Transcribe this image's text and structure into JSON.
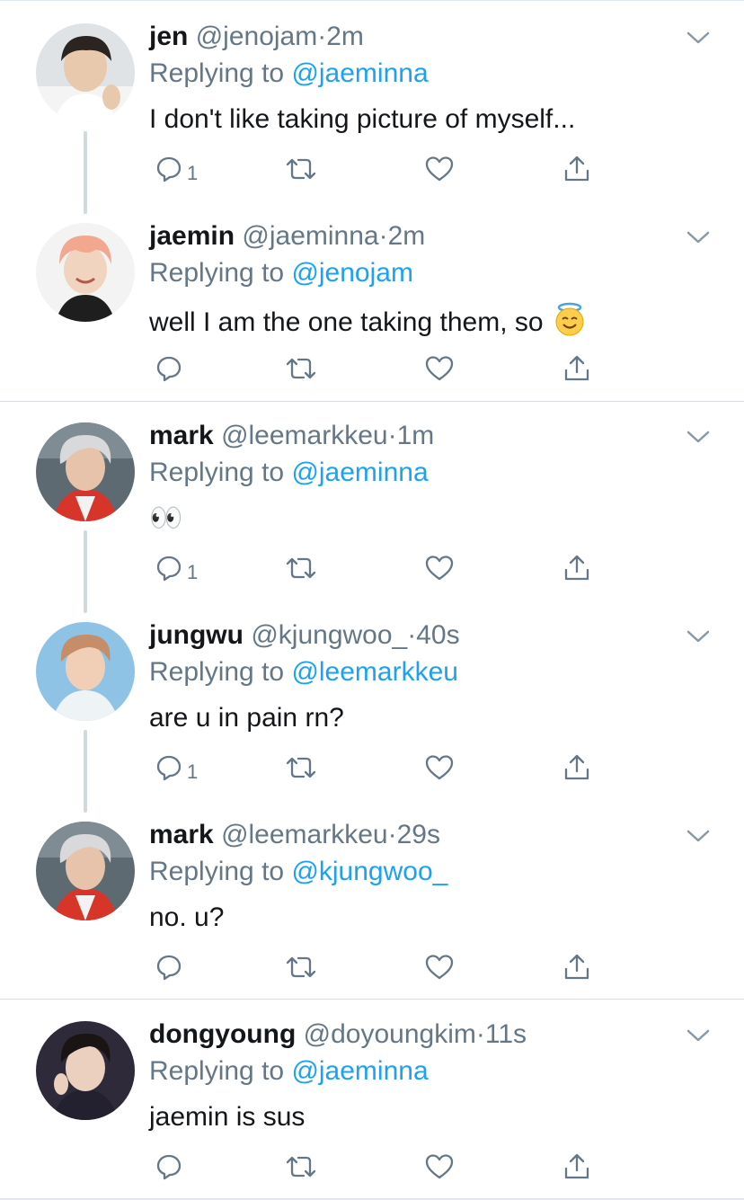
{
  "tweets": [
    {
      "name": "jen",
      "handle": "@jenojam",
      "time": "2m",
      "replying_label": "Replying to",
      "replying_to": "@jaeminna",
      "text": "I don't like taking picture of myself...",
      "reply_count": "1",
      "avatar": "avatar-jen"
    },
    {
      "name": "jaemin",
      "handle": "@jaeminna",
      "time": "2m",
      "replying_label": "Replying to",
      "replying_to": "@jenojam",
      "text": "well I am the one taking them, so",
      "text_emoji": "smiling-face-with-halo",
      "reply_count": "",
      "avatar": "avatar-jaemin"
    },
    {
      "name": "mark",
      "handle": "@leemarkkeu",
      "time": "1m",
      "replying_label": "Replying to",
      "replying_to": "@jaeminna",
      "text": "👀",
      "reply_count": "1",
      "avatar": "avatar-mark"
    },
    {
      "name": "jungwu",
      "handle": "@kjungwoo_",
      "time": "40s",
      "replying_label": "Replying to",
      "replying_to": "@leemarkkeu",
      "text": "are u in pain rn?",
      "reply_count": "1",
      "avatar": "avatar-jungwu"
    },
    {
      "name": "mark",
      "handle": "@leemarkkeu",
      "time": "29s",
      "replying_label": "Replying to",
      "replying_to": "@kjungwoo_",
      "text": "no. u?",
      "reply_count": "",
      "avatar": "avatar-mark"
    },
    {
      "name": "dongyoung",
      "handle": "@doyoungkim",
      "time": "11s",
      "replying_label": "Replying to",
      "replying_to": "@jaeminna",
      "text": "jaemin is sus",
      "reply_count": "",
      "avatar": "avatar-dongyoung"
    }
  ],
  "meta": {
    "separator_dot": "·"
  },
  "colors": {
    "accent": "#1da1f2",
    "secondary_text": "#657786",
    "primary_text": "#14171a",
    "divider": "#e1e8ed"
  },
  "icons": [
    "reply-icon",
    "retweet-icon",
    "like-icon",
    "share-icon",
    "chevron-down-icon"
  ]
}
